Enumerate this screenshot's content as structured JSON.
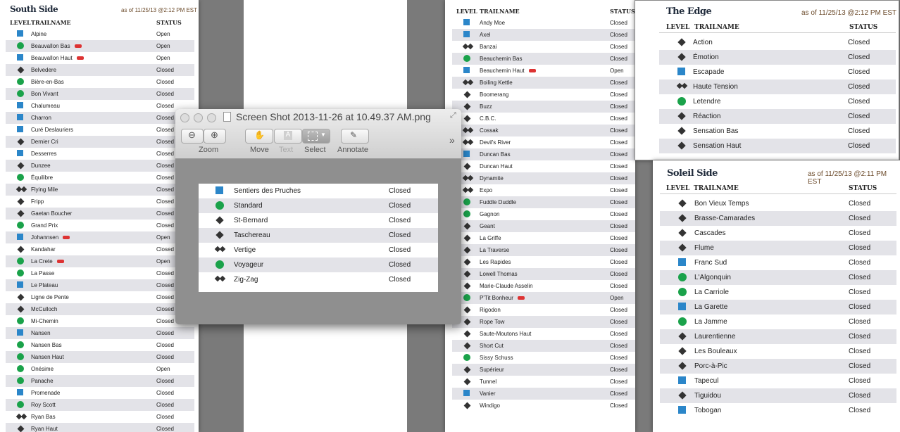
{
  "south_side": {
    "title": "South Side",
    "as_of": "as of 11/25/13 @2:12 PM EST",
    "headers": {
      "level": "LEVEL",
      "trail": "TRAILNAME",
      "status": "STATUS"
    },
    "rows": [
      {
        "level": "square",
        "name": "Alpine",
        "status": "Open",
        "badge": false
      },
      {
        "level": "circle",
        "name": "Beauvallon Bas",
        "status": "Open",
        "badge": true
      },
      {
        "level": "square",
        "name": "Beauvallon Haut",
        "status": "Open",
        "badge": true
      },
      {
        "level": "diamond",
        "name": "Belvedere",
        "status": "Closed",
        "badge": false
      },
      {
        "level": "circle",
        "name": "Bière-en-Bas",
        "status": "Closed",
        "badge": false
      },
      {
        "level": "circle",
        "name": "Bon Vivant",
        "status": "Closed",
        "badge": false
      },
      {
        "level": "square",
        "name": "Chalumeau",
        "status": "Closed",
        "badge": false
      },
      {
        "level": "square",
        "name": "Charron",
        "status": "Closed",
        "badge": false
      },
      {
        "level": "square",
        "name": "Curé Deslauriers",
        "status": "Closed",
        "badge": false
      },
      {
        "level": "diamond",
        "name": "Dernier Cri",
        "status": "Closed",
        "badge": false
      },
      {
        "level": "square",
        "name": "Desserres",
        "status": "Closed",
        "badge": false
      },
      {
        "level": "diamond",
        "name": "Dunzee",
        "status": "Closed",
        "badge": false
      },
      {
        "level": "circle",
        "name": "Équilibre",
        "status": "Closed",
        "badge": false
      },
      {
        "level": "double",
        "name": "Flying Mile",
        "status": "Closed",
        "badge": false
      },
      {
        "level": "diamond",
        "name": "Fripp",
        "status": "Closed",
        "badge": false
      },
      {
        "level": "diamond",
        "name": "Gaetan Boucher",
        "status": "Closed",
        "badge": false
      },
      {
        "level": "circle",
        "name": "Grand Prix",
        "status": "Closed",
        "badge": false
      },
      {
        "level": "square",
        "name": "Johannsen",
        "status": "Open",
        "badge": true
      },
      {
        "level": "diamond",
        "name": "Kandahar",
        "status": "Closed",
        "badge": false
      },
      {
        "level": "circle",
        "name": "La Crete",
        "status": "Open",
        "badge": true
      },
      {
        "level": "circle",
        "name": "La Passe",
        "status": "Closed",
        "badge": false
      },
      {
        "level": "square",
        "name": "Le Plateau",
        "status": "Closed",
        "badge": false
      },
      {
        "level": "diamond",
        "name": "Ligne de Pente",
        "status": "Closed",
        "badge": false
      },
      {
        "level": "diamond",
        "name": "McCulloch",
        "status": "Closed",
        "badge": false
      },
      {
        "level": "circle",
        "name": "Mi-Chemin",
        "status": "Closed",
        "badge": false
      },
      {
        "level": "square",
        "name": "Nansen",
        "status": "Closed",
        "badge": false
      },
      {
        "level": "circle",
        "name": "Nansen Bas",
        "status": "Closed",
        "badge": false
      },
      {
        "level": "circle",
        "name": "Nansen Haut",
        "status": "Closed",
        "badge": false
      },
      {
        "level": "circle",
        "name": "Onésime",
        "status": "Open",
        "badge": false
      },
      {
        "level": "circle",
        "name": "Panache",
        "status": "Closed",
        "badge": false
      },
      {
        "level": "square",
        "name": "Promenade",
        "status": "Closed",
        "badge": false
      },
      {
        "level": "circle",
        "name": "Roy Scott",
        "status": "Closed",
        "badge": false
      },
      {
        "level": "double",
        "name": "Ryan Bas",
        "status": "Closed",
        "badge": false
      },
      {
        "level": "diamond",
        "name": "Ryan Haut",
        "status": "Closed",
        "badge": false
      }
    ]
  },
  "middle_list": {
    "headers": {
      "level": "LEVEL",
      "trail": "TRAILNAME",
      "status": "STATUS"
    },
    "rows": [
      {
        "level": "square",
        "name": "Andy Moe",
        "status": "Closed",
        "badge": false
      },
      {
        "level": "square",
        "name": "Axel",
        "status": "Closed",
        "badge": false
      },
      {
        "level": "double",
        "name": "Banzai",
        "status": "Closed",
        "badge": false
      },
      {
        "level": "circle",
        "name": "Beauchemin Bas",
        "status": "Closed",
        "badge": false
      },
      {
        "level": "square",
        "name": "Beauchemin Haut",
        "status": "Open",
        "badge": true
      },
      {
        "level": "double",
        "name": "Boiling Kettle",
        "status": "Closed",
        "badge": false
      },
      {
        "level": "diamond",
        "name": "Boomerang",
        "status": "Closed",
        "badge": false
      },
      {
        "level": "diamond",
        "name": "Buzz",
        "status": "Closed",
        "badge": false
      },
      {
        "level": "diamond",
        "name": "C.B.C.",
        "status": "Closed",
        "badge": false
      },
      {
        "level": "double",
        "name": "Cossak",
        "status": "Closed",
        "badge": false
      },
      {
        "level": "double",
        "name": "Devil's River",
        "status": "Closed",
        "badge": false
      },
      {
        "level": "square",
        "name": "Duncan Bas",
        "status": "Closed",
        "badge": false
      },
      {
        "level": "diamond",
        "name": "Duncan Haut",
        "status": "Closed",
        "badge": false
      },
      {
        "level": "double",
        "name": "Dynamite",
        "status": "Closed",
        "badge": false
      },
      {
        "level": "double",
        "name": "Expo",
        "status": "Closed",
        "badge": false
      },
      {
        "level": "circle",
        "name": "Fuddle Duddle",
        "status": "Closed",
        "badge": false
      },
      {
        "level": "circle",
        "name": "Gagnon",
        "status": "Closed",
        "badge": false
      },
      {
        "level": "diamond",
        "name": "Geant",
        "status": "Closed",
        "badge": false
      },
      {
        "level": "diamond",
        "name": "La Griffe",
        "status": "Closed",
        "badge": false
      },
      {
        "level": "diamond",
        "name": "La Traverse",
        "status": "Closed",
        "badge": false
      },
      {
        "level": "diamond",
        "name": "Les Rapides",
        "status": "Closed",
        "badge": false
      },
      {
        "level": "diamond",
        "name": "Lowell Thomas",
        "status": "Closed",
        "badge": false
      },
      {
        "level": "diamond",
        "name": "Marie-Claude Asselin",
        "status": "Closed",
        "badge": false
      },
      {
        "level": "circle",
        "name": "P'Tit Bonheur",
        "status": "Open",
        "badge": true
      },
      {
        "level": "diamond",
        "name": "Rigodon",
        "status": "Closed",
        "badge": false
      },
      {
        "level": "diamond",
        "name": "Rope Tow",
        "status": "Closed",
        "badge": false
      },
      {
        "level": "diamond",
        "name": "Saute-Moutons Haut",
        "status": "Closed",
        "badge": false
      },
      {
        "level": "diamond",
        "name": "Short Cut",
        "status": "Closed",
        "badge": false
      },
      {
        "level": "circle",
        "name": "Sissy Schuss",
        "status": "Closed",
        "badge": false
      },
      {
        "level": "diamond",
        "name": "Supérieur",
        "status": "Closed",
        "badge": false
      },
      {
        "level": "diamond",
        "name": "Tunnel",
        "status": "Closed",
        "badge": false
      },
      {
        "level": "square",
        "name": "Vanier",
        "status": "Closed",
        "badge": false
      },
      {
        "level": "diamond",
        "name": "Windigo",
        "status": "Closed",
        "badge": false
      }
    ]
  },
  "the_edge": {
    "title": "The Edge",
    "as_of": "as of 11/25/13 @2:12 PM EST",
    "headers": {
      "level": "LEVEL",
      "trail": "TRAILNAME",
      "status": "STATUS"
    },
    "rows": [
      {
        "level": "diamond",
        "name": "Action",
        "status": "Closed"
      },
      {
        "level": "diamond",
        "name": "Émotion",
        "status": "Closed"
      },
      {
        "level": "square",
        "name": "Escapade",
        "status": "Closed"
      },
      {
        "level": "double",
        "name": "Haute Tension",
        "status": "Closed"
      },
      {
        "level": "circle",
        "name": "Letendre",
        "status": "Closed"
      },
      {
        "level": "diamond",
        "name": "Réaction",
        "status": "Closed"
      },
      {
        "level": "diamond",
        "name": "Sensation Bas",
        "status": "Closed"
      },
      {
        "level": "diamond",
        "name": "Sensation Haut",
        "status": "Closed"
      }
    ]
  },
  "soleil_side": {
    "title": "Soleil Side",
    "as_of": "as of 11/25/13 @2:11 PM EST",
    "headers": {
      "level": "LEVEL",
      "trail": "TRAILNAME",
      "status": "STATUS"
    },
    "rows": [
      {
        "level": "diamond",
        "name": "Bon Vieux Temps",
        "status": "Closed"
      },
      {
        "level": "diamond",
        "name": "Brasse-Camarades",
        "status": "Closed"
      },
      {
        "level": "diamond",
        "name": "Cascades",
        "status": "Closed"
      },
      {
        "level": "diamond",
        "name": "Flume",
        "status": "Closed"
      },
      {
        "level": "square",
        "name": "Franc Sud",
        "status": "Closed"
      },
      {
        "level": "circle",
        "name": "L'Algonquin",
        "status": "Closed"
      },
      {
        "level": "circle",
        "name": "La Carriole",
        "status": "Closed"
      },
      {
        "level": "square",
        "name": "La Garette",
        "status": "Closed"
      },
      {
        "level": "circle",
        "name": "La Jamme",
        "status": "Closed"
      },
      {
        "level": "diamond",
        "name": "Laurentienne",
        "status": "Closed"
      },
      {
        "level": "diamond",
        "name": "Les Bouleaux",
        "status": "Closed"
      },
      {
        "level": "diamond",
        "name": "Porc-à-Pic",
        "status": "Closed"
      },
      {
        "level": "square",
        "name": "Tapecul",
        "status": "Closed"
      },
      {
        "level": "diamond",
        "name": "Tiguidou",
        "status": "Closed"
      },
      {
        "level": "square",
        "name": "Tobogan",
        "status": "Closed"
      }
    ]
  },
  "preview_window": {
    "title": "Screen Shot 2013-11-26 at 10.49.37 AM.png",
    "toolbar": {
      "zoom": "Zoom",
      "move": "Move",
      "text": "Text",
      "select": "Select",
      "annotate": "Annotate",
      "overflow": "»"
    },
    "rows": [
      {
        "level": "square",
        "name": "Sentiers des Pruches",
        "status": "Closed"
      },
      {
        "level": "circle",
        "name": "Standard",
        "status": "Closed"
      },
      {
        "level": "diamond",
        "name": "St-Bernard",
        "status": "Closed"
      },
      {
        "level": "diamond",
        "name": "Taschereau",
        "status": "Closed"
      },
      {
        "level": "double",
        "name": "Vertige",
        "status": "Closed"
      },
      {
        "level": "circle",
        "name": "Voyageur",
        "status": "Closed"
      },
      {
        "level": "double",
        "name": "Zig-Zag",
        "status": "Closed"
      }
    ]
  },
  "icons": {
    "square": "blue-square-icon",
    "circle": "green-circle-icon",
    "diamond": "black-diamond-icon",
    "double": "double-black-diamond-icon"
  },
  "colors": {
    "blue": "#2b86c9",
    "green": "#1aa24a",
    "black": "#333333",
    "badge": "#dd3333",
    "as_of": "#6b4a2a"
  }
}
